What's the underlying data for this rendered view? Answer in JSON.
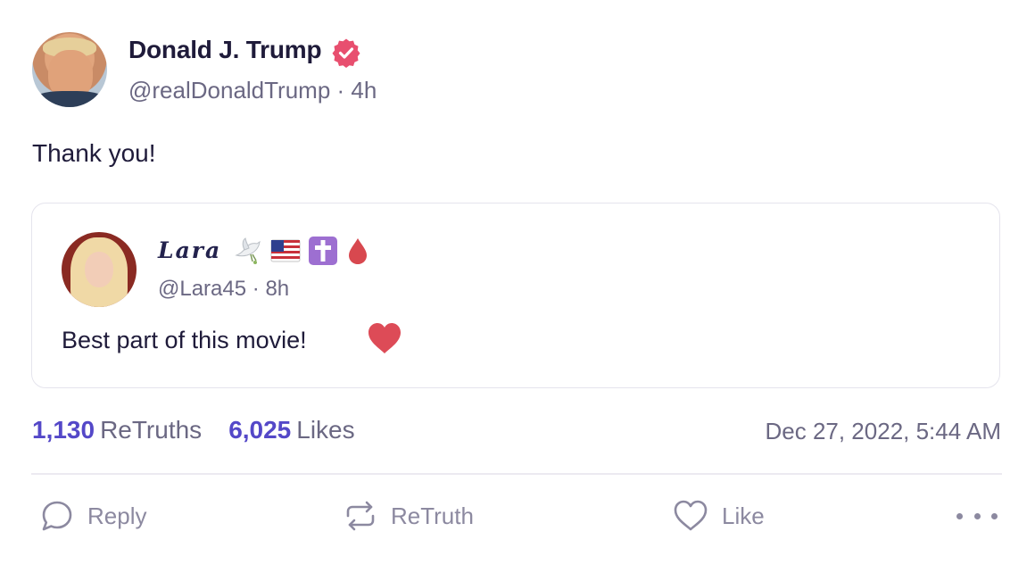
{
  "post": {
    "author": {
      "name": "Donald J. Trump",
      "handle": "@realDonaldTrump",
      "relative_time": "4h",
      "verified": true
    },
    "body": "Thank you!",
    "quoted_post": {
      "author": {
        "name": "Lara",
        "name_emojis": [
          "dove-icon",
          "us-flag-icon",
          "cross-icon",
          "blood-drop-icon"
        ],
        "handle": "@Lara45",
        "relative_time": "8h"
      },
      "body": "Best part of this movie!",
      "body_emoji": "red-heart-icon"
    },
    "stats": {
      "retruths_count": "1,130",
      "retruths_label": "ReTruths",
      "likes_count": "6,025",
      "likes_label": "Likes"
    },
    "timestamp": "Dec 27, 2022, 5:44 AM",
    "actions": {
      "reply_label": "Reply",
      "retruth_label": "ReTruth",
      "like_label": "Like"
    }
  },
  "colors": {
    "accent": "#5448c8",
    "verified_badge": "#e84f6f",
    "muted_text": "#6b6883",
    "heart": "#dd4b57"
  }
}
